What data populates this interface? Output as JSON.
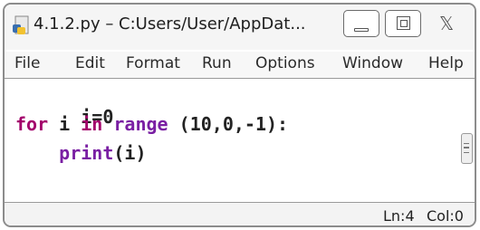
{
  "window": {
    "title": "4.1.2.py – C:Users/User/AppDat...",
    "icon": "python-file-icon",
    "controls": {
      "minimize": "minimize-icon",
      "maximize": "maximize-icon",
      "close_glyph": "𝕏"
    }
  },
  "menu": {
    "items": [
      "File",
      "Edit",
      "Format",
      "Run",
      "Options",
      "Window",
      "Help"
    ]
  },
  "code": {
    "line1": {
      "text": "i=0"
    },
    "line2": {
      "kw_for": "for",
      "mid": " i ",
      "kw_in": "in",
      "sp": " ",
      "builtin": "range",
      "args": " (10,0,-1):"
    },
    "line3": {
      "indent": "    ",
      "builtin": "print",
      "args": "(i)"
    }
  },
  "status": {
    "line": "Ln:4",
    "col": "Col:0"
  },
  "colors": {
    "keyword": "#a3006b",
    "builtin": "#7a1fa3",
    "text": "#222222"
  }
}
